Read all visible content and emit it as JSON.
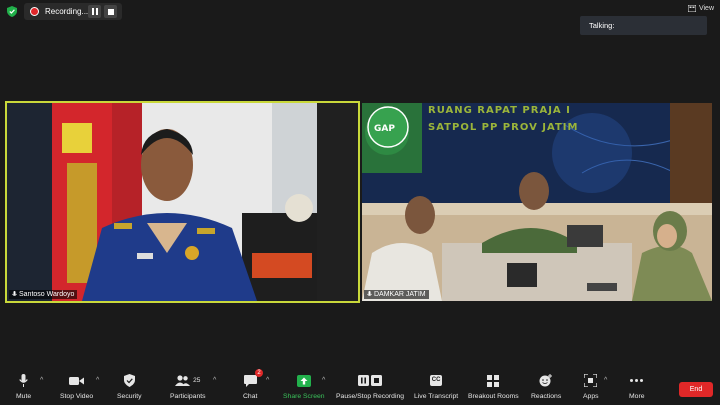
{
  "recording": {
    "label": "Recording..."
  },
  "header": {
    "view_label": "View",
    "talking_label": "Talking:"
  },
  "tiles": {
    "left_name": "Santoso Wardoyo",
    "right_name": "DAMKAR JATIM",
    "right_banner_line1": "RUANG RAPAT PRAJA I",
    "right_banner_line2": "SATPOL PP PROV JATIM",
    "right_logo_text": "GAP"
  },
  "toolbar": {
    "mute": "Mute",
    "stop_video": "Stop Video",
    "security": "Security",
    "participants": "Participants",
    "participants_count": "25",
    "chat": "Chat",
    "chat_badge": "2",
    "share_screen": "Share Screen",
    "pause_recording": "Pause/Stop Recording",
    "live_transcript": "Live Transcript",
    "live_transcript_icon": "CC",
    "breakout_rooms": "Breakout Rooms",
    "reactions": "Reactions",
    "apps": "Apps",
    "more": "More",
    "end": "End"
  },
  "colors": {
    "active_speaker": "#c9d83a",
    "share_green": "#22b14c",
    "end_red": "#e02828",
    "record_red": "#e0272b"
  }
}
